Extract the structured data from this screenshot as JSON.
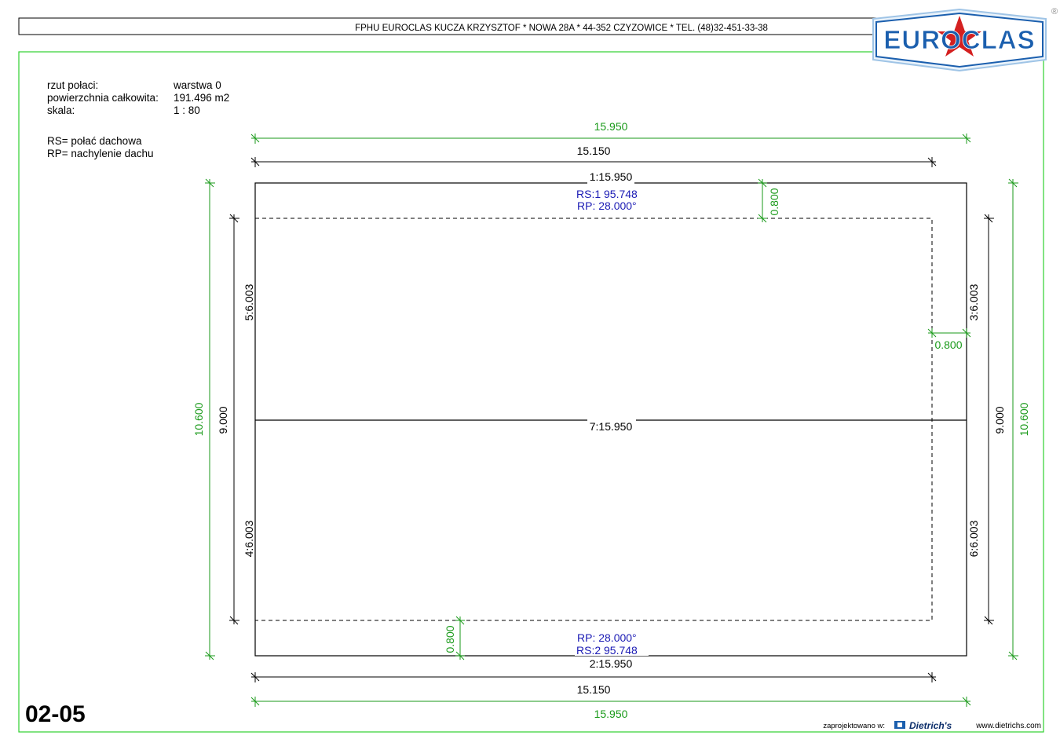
{
  "header": {
    "company_line": "FPHU EUROCLAS KUCZA KRZYSZTOF * NOWA 28A * 44-352 CZYZOWICE * TEL. (48)32-451-33-38",
    "logo_text": "EUROCLAS",
    "registered_mark": "®"
  },
  "info": {
    "label_roof": "rzut połaci:",
    "value_roof": "warstwa 0",
    "label_area": "powierzchnia całkowita:",
    "value_area": "191.496 m2",
    "label_scale": "skala:",
    "value_scale": "1 : 80",
    "legend_rs": "RS= połać dachowa",
    "legend_rp": "RP= nachylenie dachu"
  },
  "dimensions": {
    "top_outer": "15.950",
    "top_inner": "15.150",
    "bottom_inner": "15.150",
    "bottom_outer": "15.950",
    "left_outer": "10.600",
    "left_inner": "9.000",
    "right_inner": "9.000",
    "right_outer": "10.600",
    "overhang_top": "0.800",
    "overhang_right": "0.800",
    "overhang_bottom": "0.800"
  },
  "edges": {
    "edge_1": "1:15.950",
    "edge_2": "2:15.950",
    "edge_7": "7:15.950",
    "edge_5": "5:6.003",
    "edge_4": "4:6.003",
    "edge_3": "3:6.003",
    "edge_6": "6:6.003"
  },
  "roof_faces": {
    "face1_rs": "RS:1   95.748",
    "face1_rp": "RP:   28.000°",
    "face2_rp": "RP:   28.000°",
    "face2_rs": "RS:2   95.748"
  },
  "footer": {
    "sheet_number": "02-05",
    "designed_with": "zaprojektowano w:",
    "software": "Dietrich's",
    "website": "www.dietrichs.com"
  },
  "colors": {
    "dimension_green": "#1a9a1a",
    "face_blue": "#1a1ab4",
    "logo_blue": "#1b5fae",
    "logo_red": "#d42020"
  }
}
